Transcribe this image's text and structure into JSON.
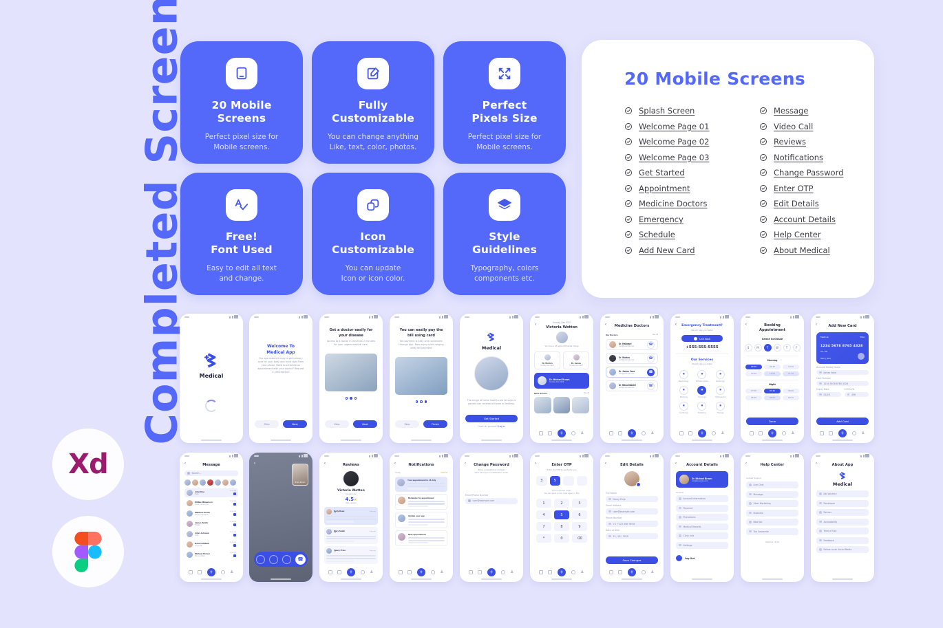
{
  "meta": {
    "vertical_title": "Completed Screens",
    "background_color": "#e3e3fd",
    "accent_color": "#5468fa",
    "panel_color": "#ffffff"
  },
  "logos": [
    {
      "name": "Adobe Xd",
      "label": "Xd",
      "color": "#9b1b6e"
    },
    {
      "name": "Figma",
      "label": "",
      "color": "#f24e1e"
    }
  ],
  "feature_cards": [
    {
      "icon": "mobile-device-icon",
      "title": "20 Mobile\nScreens",
      "title_line1": "20 Mobile",
      "title_line2": "Screens",
      "desc_line1": "Perfect pixel size for",
      "desc_line2": "Mobile screens."
    },
    {
      "icon": "edit-pencil-icon",
      "title_line1": "Fully",
      "title_line2": "Customizable",
      "desc_line1": "You can change anything",
      "desc_line2": "Like, text, color, photos."
    },
    {
      "icon": "resize-arrows-icon",
      "title_line1": "Perfect",
      "title_line2": "Pixels Size",
      "desc_line1": "Perfect pixel size for",
      "desc_line2": "Mobile screens."
    },
    {
      "icon": "font-check-icon",
      "title_line1": "Free!",
      "title_line2": "Font Used",
      "desc_line1": "Easy to edit all text",
      "desc_line2": "and change."
    },
    {
      "icon": "copy-shapes-icon",
      "title_line1": "Icon",
      "title_line2": "Customizable",
      "desc_line1": "You can update",
      "desc_line2": "Icon or icon color."
    },
    {
      "icon": "layers-icon",
      "title_line1": "Style",
      "title_line2": "Guidelines",
      "desc_line1": "Typography, colors",
      "desc_line2": "components etc."
    }
  ],
  "panel": {
    "heading": "20 Mobile Screens",
    "left_column": [
      "Splash Screen",
      "Welcome Page 01",
      "Welcome Page 02",
      "Welcome Page 03",
      "Get Started",
      "Appointment",
      "Medicine Doctors",
      "Emergency",
      "Schedule",
      "Add New Card"
    ],
    "right_column": [
      "Message",
      "Video Call",
      "Reviews",
      "Notifications",
      "Change Password",
      "Enter OTP",
      "Edit Details",
      "Account Details",
      "Help Center",
      "About Medical"
    ]
  },
  "mockups": {
    "splash": {
      "brand": "Medical"
    },
    "welcome01": {
      "title_line1": "Welcome To",
      "title_line2": "Medical App",
      "body": "Our app makes it easy to get primary care for your body and mind right from your phone. Need to schedule an appointment with your doctor? Request a prescription?",
      "skip": "Skip",
      "next": "Next"
    },
    "welcome02": {
      "title_line1": "Get a doctor easily for",
      "title_line2": "your disease",
      "body": "Access to a doctor in less than 2 minutes for your urgent medical care.",
      "skip": "Skip",
      "next": "Next"
    },
    "welcome03": {
      "title_line1": "You can easily pay the",
      "title_line2": "bill using card",
      "body": "Bill payment is easy and convenient through App. Now enjoy quick ranging utility bill payment.",
      "skip": "Skip",
      "next": "Finish"
    },
    "get_started": {
      "brand": "Medical",
      "body": "The range of home health care services a patient can receive at home is limitless.",
      "button": "Get Started",
      "footer": "Have an account?",
      "footer_link": "Log in"
    },
    "appointment": {
      "date": "Sunday, Dec 2022",
      "name": "Victoria Wotton",
      "subtitle": "You have 03 appointments today",
      "doctors": [
        {
          "name": "Dr. Wotton",
          "time": "Sunday, Dec 2022"
        },
        {
          "name": "Dr. James",
          "time": "Sunday, Dec 2022"
        }
      ],
      "featured": {
        "name": "Dr. Michael Brown",
        "time": "Sunday, Dec 2022"
      },
      "section": "More Doctors",
      "see_all": "See All"
    },
    "medicine_doctors": {
      "title": "Medicine Doctors",
      "section": "Our Doctors",
      "see_all": "See All",
      "rows": [
        {
          "name": "Dr. Hallward",
          "email": "user@example.com"
        },
        {
          "name": "Dr. Wotton",
          "email": "user@example.com"
        },
        {
          "name": "Dr. James Vane",
          "email": "user@example.com"
        },
        {
          "name": "Dr. Basuimabdel",
          "email": "user@example.com"
        }
      ]
    },
    "emergency": {
      "title": "Emergency Treatment?",
      "subtitle": "We will help you faster",
      "call_button": "Call Now",
      "phone": "+555-555-5555",
      "services_title": "Our Services",
      "services_sub": "We will help you faster",
      "services": [
        "Nephrology",
        "Palliative Care",
        "Radiology",
        "Medicine",
        "Oncology",
        "Orthopedics",
        "Cardiology",
        "Pediatrics",
        "Therapy"
      ]
    },
    "booking": {
      "title_line1": "Booking",
      "title_line2": "Appointment",
      "section": "Select Schedule",
      "days": [
        "S",
        "M",
        "T",
        "W",
        "T",
        "F"
      ],
      "morning": "Morning",
      "night": "Night",
      "morning_slots": [
        "09:00",
        "09:30",
        "10:00",
        "10:30",
        "11:00",
        "11:30"
      ],
      "night_slots": [
        "07:00",
        "07:30",
        "08:00",
        "08:30",
        "09:00",
        "09:30"
      ],
      "button": "Done"
    },
    "add_card": {
      "title": "Add New Card",
      "card_brand": "Medical",
      "card_type": "VISA",
      "card_number": "1234 5678 8765 4328",
      "card_exp": "02 / 28",
      "card_name": "Marry Jane",
      "label_name": "Account Holder Name",
      "value_name": "James Vane",
      "label_number": "Card Number",
      "value_number": "1234 5678 8765 4328",
      "label_expiry": "Expiry Date",
      "value_expiry": "02/28",
      "label_cvv": "CVV/CVN",
      "value_cvv": "456",
      "button": "Add Card"
    },
    "message": {
      "title": "Message",
      "search_placeholder": "Search...",
      "rows": [
        {
          "name": "John Doe",
          "preview": "Hello",
          "time": "12:30 PM"
        },
        {
          "name": "Willkie Mikaelson",
          "preview": "There you are now",
          "time": "12:30 PM"
        },
        {
          "name": "Matthew Smith",
          "preview": "See you tomorrow",
          "time": "12:30 PM"
        },
        {
          "name": "James Smith",
          "preview": "Thanks",
          "time": "12:30 PM"
        },
        {
          "name": "John Johnson",
          "preview": "Hello",
          "time": "12:30 PM"
        },
        {
          "name": "Robert Willard",
          "preview": "Yes, I will",
          "time": "12:30 PM"
        },
        {
          "name": "Michael Brown",
          "preview": "Not a problem",
          "time": "12:30 PM"
        }
      ]
    },
    "video_call": {
      "caller": "Emily Brown"
    },
    "reviews": {
      "title": "Reviews",
      "name": "Victoria Wotton",
      "specialty": "Dental Care",
      "rating": "4.5",
      "rating_sub": "900+ reviews",
      "items": [
        {
          "name": "Kelly Dean",
          "rating": "4.9",
          "time": "1 day ago"
        },
        {
          "name": "Mary Smith",
          "rating": "4.8",
          "time": "2 day ago"
        },
        {
          "name": "Fanny Price",
          "rating": "4.7",
          "time": "3 day ago"
        }
      ]
    },
    "notifications": {
      "title": "Notifications",
      "today": "Today",
      "clear": "Clear all",
      "items": [
        "Your appointment for 16 July",
        "Reminder for appointment",
        "Update your app",
        "Next Appointment"
      ]
    },
    "change_password": {
      "title": "Change Password",
      "subtitle_line1": "Enter email/phone number",
      "subtitle_line2": "we'll send you a verification code.",
      "label": "Email/Phone Number",
      "value": "user@example.com"
    },
    "enter_otp": {
      "title": "Enter OTP",
      "subtitle": "Enter the OTP to verify it's you",
      "digits": [
        "3",
        "5",
        "",
        ""
      ],
      "resend_line1": "Didn't receive code?",
      "resend_line2": "You can send a new code again in 59s",
      "keys": [
        "1",
        "2",
        "3",
        "4",
        "5",
        "6",
        "7",
        "8",
        "9",
        "*",
        "0",
        "⌫"
      ]
    },
    "edit_details": {
      "title": "Edit Details",
      "label_name": "Full Name",
      "value_name": "Fanny Price",
      "label_email": "Email Address",
      "value_email": "user@example.com",
      "label_phone": "Phone Number",
      "value_phone": "+1 +123 456 789 8",
      "label_dob": "Date of Birth",
      "value_dob": "14 / 05 / 2020",
      "button": "Save Changes"
    },
    "account_details": {
      "title": "Account Details",
      "user_name": "Dr. Michael Brown",
      "user_email": "user@example.com",
      "section": "General",
      "items": [
        "Account Information",
        "Payment",
        "Promotions",
        "Medical Records",
        "Clinic Info",
        "Settings"
      ],
      "logout": "Log Out"
    },
    "help_center": {
      "title": "Help Center",
      "section": "Contact Support",
      "items": [
        "Live Chat",
        "Message",
        "Viber Marketing",
        "Business",
        "New Job",
        "Top Corporate"
      ],
      "version": "Medical v7.50"
    },
    "about_app": {
      "title": "About App",
      "brand": "Medical",
      "items": [
        "Job Vacancy",
        "Developer",
        "Partner",
        "Accessibility",
        "Term of Use",
        "Feedback",
        "Follow us on Social Media"
      ]
    }
  }
}
